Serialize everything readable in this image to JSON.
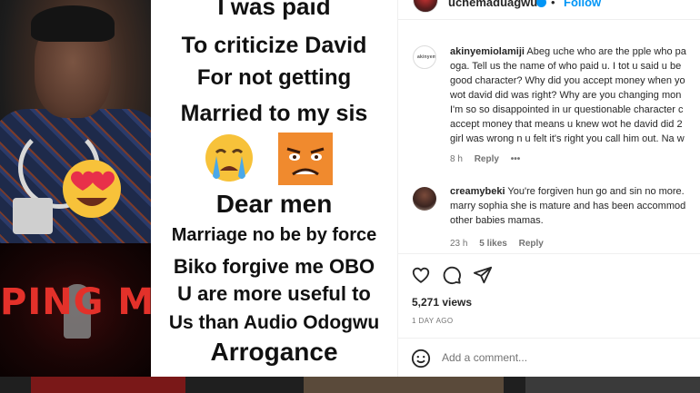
{
  "media": {
    "banner_text": "PING ME",
    "caption_lines": [
      "I was paid",
      "To criticize David",
      "For not getting",
      "Married to my sis",
      "Dear men",
      "Marriage no be by force",
      "Biko forgive me OBO",
      "U are more useful to",
      "Us than Audio Odogwu",
      "Arrogance"
    ]
  },
  "post": {
    "owner": "uchemaduagwu",
    "separator": "•",
    "follow_label": "Follow"
  },
  "comments": [
    {
      "username": "akinyemiolamiji",
      "lines": [
        " Abeg uche who are the pple who pa",
        "oga. Tell us the name of who paid u. I tot u said u be",
        "good character? Why did you accept money when yo",
        "wot david did was right? Why are you changing mon",
        "I'm so so disappointed in ur questionable character c",
        "accept money that means u knew wot he david did 2",
        "girl was wrong n u felt it's right you call him out. Na w"
      ],
      "time": "8 h",
      "reply_label": "Reply",
      "more_label": "•••"
    },
    {
      "username": "creamybeki",
      "lines": [
        " You're forgiven hun go and sin no more.",
        "marry sophia she is mature and has been accommod",
        "other babies mamas."
      ],
      "time": "23 h",
      "likes": "5 likes",
      "reply_label": "Reply"
    }
  ],
  "stats": {
    "views": "5,271 views",
    "time_ago": "1 DAY AGO"
  },
  "composer": {
    "placeholder": "Add a comment..."
  },
  "icons": [
    "heart-icon",
    "comment-icon",
    "share-icon",
    "smiley-icon",
    "verified-badge-icon",
    "ellipsis-icon"
  ],
  "colors": {
    "link_blue": "#0095f6",
    "muted_text": "#737373",
    "banner_red": "#e3312a"
  }
}
